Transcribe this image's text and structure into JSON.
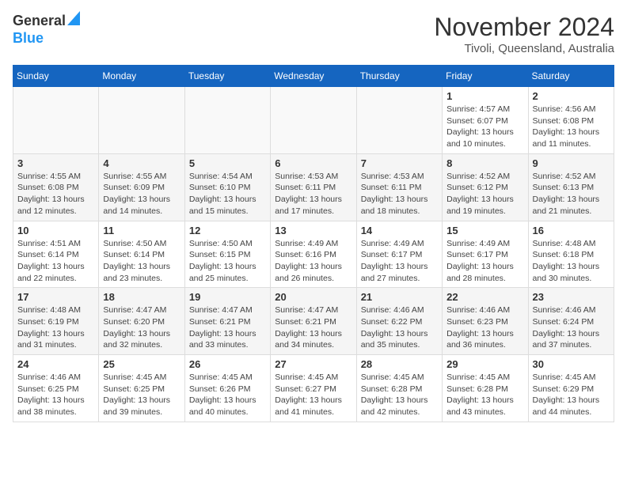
{
  "header": {
    "logo_general": "General",
    "logo_blue": "Blue",
    "month_year": "November 2024",
    "location": "Tivoli, Queensland, Australia"
  },
  "days_of_week": [
    "Sunday",
    "Monday",
    "Tuesday",
    "Wednesday",
    "Thursday",
    "Friday",
    "Saturday"
  ],
  "weeks": [
    [
      {
        "day": "",
        "info": ""
      },
      {
        "day": "",
        "info": ""
      },
      {
        "day": "",
        "info": ""
      },
      {
        "day": "",
        "info": ""
      },
      {
        "day": "",
        "info": ""
      },
      {
        "day": "1",
        "info": "Sunrise: 4:57 AM\nSunset: 6:07 PM\nDaylight: 13 hours and 10 minutes."
      },
      {
        "day": "2",
        "info": "Sunrise: 4:56 AM\nSunset: 6:08 PM\nDaylight: 13 hours and 11 minutes."
      }
    ],
    [
      {
        "day": "3",
        "info": "Sunrise: 4:55 AM\nSunset: 6:08 PM\nDaylight: 13 hours and 12 minutes."
      },
      {
        "day": "4",
        "info": "Sunrise: 4:55 AM\nSunset: 6:09 PM\nDaylight: 13 hours and 14 minutes."
      },
      {
        "day": "5",
        "info": "Sunrise: 4:54 AM\nSunset: 6:10 PM\nDaylight: 13 hours and 15 minutes."
      },
      {
        "day": "6",
        "info": "Sunrise: 4:53 AM\nSunset: 6:11 PM\nDaylight: 13 hours and 17 minutes."
      },
      {
        "day": "7",
        "info": "Sunrise: 4:53 AM\nSunset: 6:11 PM\nDaylight: 13 hours and 18 minutes."
      },
      {
        "day": "8",
        "info": "Sunrise: 4:52 AM\nSunset: 6:12 PM\nDaylight: 13 hours and 19 minutes."
      },
      {
        "day": "9",
        "info": "Sunrise: 4:52 AM\nSunset: 6:13 PM\nDaylight: 13 hours and 21 minutes."
      }
    ],
    [
      {
        "day": "10",
        "info": "Sunrise: 4:51 AM\nSunset: 6:14 PM\nDaylight: 13 hours and 22 minutes."
      },
      {
        "day": "11",
        "info": "Sunrise: 4:50 AM\nSunset: 6:14 PM\nDaylight: 13 hours and 23 minutes."
      },
      {
        "day": "12",
        "info": "Sunrise: 4:50 AM\nSunset: 6:15 PM\nDaylight: 13 hours and 25 minutes."
      },
      {
        "day": "13",
        "info": "Sunrise: 4:49 AM\nSunset: 6:16 PM\nDaylight: 13 hours and 26 minutes."
      },
      {
        "day": "14",
        "info": "Sunrise: 4:49 AM\nSunset: 6:17 PM\nDaylight: 13 hours and 27 minutes."
      },
      {
        "day": "15",
        "info": "Sunrise: 4:49 AM\nSunset: 6:17 PM\nDaylight: 13 hours and 28 minutes."
      },
      {
        "day": "16",
        "info": "Sunrise: 4:48 AM\nSunset: 6:18 PM\nDaylight: 13 hours and 30 minutes."
      }
    ],
    [
      {
        "day": "17",
        "info": "Sunrise: 4:48 AM\nSunset: 6:19 PM\nDaylight: 13 hours and 31 minutes."
      },
      {
        "day": "18",
        "info": "Sunrise: 4:47 AM\nSunset: 6:20 PM\nDaylight: 13 hours and 32 minutes."
      },
      {
        "day": "19",
        "info": "Sunrise: 4:47 AM\nSunset: 6:21 PM\nDaylight: 13 hours and 33 minutes."
      },
      {
        "day": "20",
        "info": "Sunrise: 4:47 AM\nSunset: 6:21 PM\nDaylight: 13 hours and 34 minutes."
      },
      {
        "day": "21",
        "info": "Sunrise: 4:46 AM\nSunset: 6:22 PM\nDaylight: 13 hours and 35 minutes."
      },
      {
        "day": "22",
        "info": "Sunrise: 4:46 AM\nSunset: 6:23 PM\nDaylight: 13 hours and 36 minutes."
      },
      {
        "day": "23",
        "info": "Sunrise: 4:46 AM\nSunset: 6:24 PM\nDaylight: 13 hours and 37 minutes."
      }
    ],
    [
      {
        "day": "24",
        "info": "Sunrise: 4:46 AM\nSunset: 6:25 PM\nDaylight: 13 hours and 38 minutes."
      },
      {
        "day": "25",
        "info": "Sunrise: 4:45 AM\nSunset: 6:25 PM\nDaylight: 13 hours and 39 minutes."
      },
      {
        "day": "26",
        "info": "Sunrise: 4:45 AM\nSunset: 6:26 PM\nDaylight: 13 hours and 40 minutes."
      },
      {
        "day": "27",
        "info": "Sunrise: 4:45 AM\nSunset: 6:27 PM\nDaylight: 13 hours and 41 minutes."
      },
      {
        "day": "28",
        "info": "Sunrise: 4:45 AM\nSunset: 6:28 PM\nDaylight: 13 hours and 42 minutes."
      },
      {
        "day": "29",
        "info": "Sunrise: 4:45 AM\nSunset: 6:28 PM\nDaylight: 13 hours and 43 minutes."
      },
      {
        "day": "30",
        "info": "Sunrise: 4:45 AM\nSunset: 6:29 PM\nDaylight: 13 hours and 44 minutes."
      }
    ]
  ]
}
